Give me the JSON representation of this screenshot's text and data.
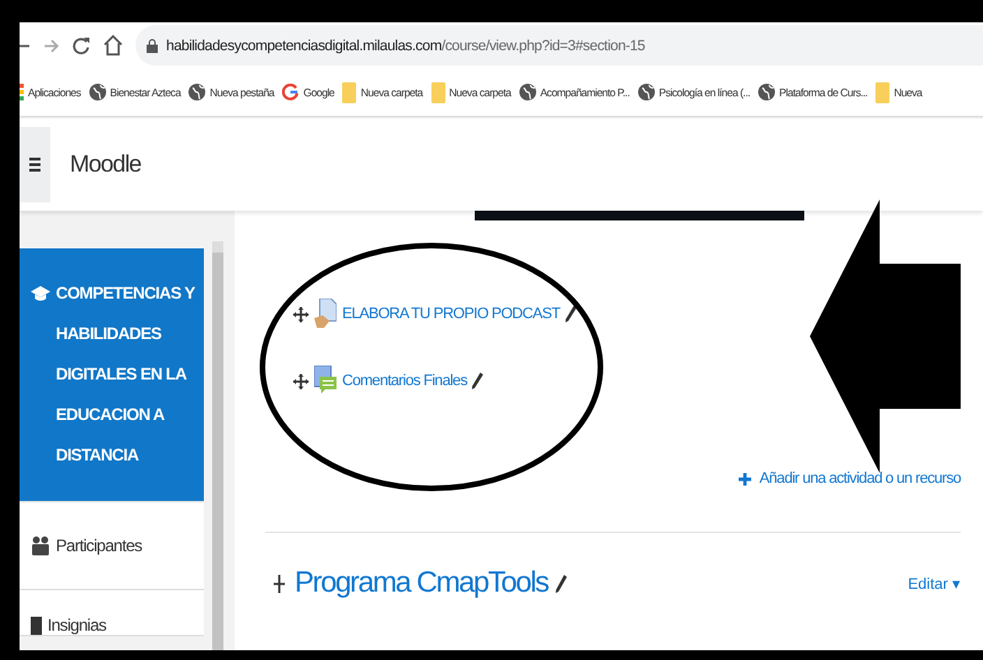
{
  "browser": {
    "url_host": "habilidadesycompetenciasdigital.milaulas.com",
    "url_path": "/course/view.php?id=3#section-15",
    "bookmarks": [
      {
        "kind": "apps",
        "label": "Aplicaciones"
      },
      {
        "kind": "globe",
        "label": "Bienestar Azteca"
      },
      {
        "kind": "globe",
        "label": "Nueva pestaña"
      },
      {
        "kind": "google",
        "label": "Google"
      },
      {
        "kind": "folder",
        "label": "Nueva carpeta"
      },
      {
        "kind": "folder",
        "label": "Nueva carpeta"
      },
      {
        "kind": "globe",
        "label": "Acompañamiento P..."
      },
      {
        "kind": "globe",
        "label": "Psicología en línea (..."
      },
      {
        "kind": "globe",
        "label": "Plataforma de Curs..."
      },
      {
        "kind": "folder",
        "label": "Nueva"
      }
    ]
  },
  "navbar": {
    "title": "Moodle"
  },
  "sidebar": {
    "items": [
      {
        "kind": "course",
        "label": "COMPETENCIAS Y HABILIDADES DIGITALES EN LA EDUCACION A DISTANCIA",
        "selected": true
      },
      {
        "kind": "participants",
        "label": "Participantes",
        "selected": false
      },
      {
        "kind": "badges",
        "label": "Insignias",
        "selected": false
      }
    ]
  },
  "section": {
    "activities": [
      {
        "kind": "assignment",
        "label": "ELABORA TU PROPIO PODCAST"
      },
      {
        "kind": "forum",
        "label": "Comentarios Finales"
      }
    ],
    "add_link": "Añadir una actividad o un recurso"
  },
  "next_section": {
    "title": "Programa CmapTools",
    "edit_menu": "Editar ▾"
  }
}
